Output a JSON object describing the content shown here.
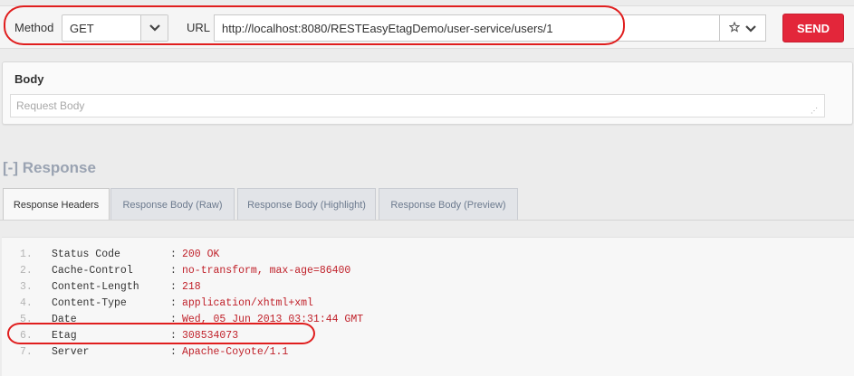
{
  "request": {
    "method_label": "Method",
    "method_value": "GET",
    "url_label": "URL",
    "url_value": "http://localhost:8080/RESTEasyEtagDemo/user-service/users/1",
    "send_label": "SEND"
  },
  "body": {
    "title": "Body",
    "placeholder": "Request Body"
  },
  "response": {
    "title": "[-] Response",
    "tabs": [
      {
        "label": "Response Headers",
        "active": true
      },
      {
        "label": "Response Body (Raw)",
        "active": false
      },
      {
        "label": "Response Body (Highlight)",
        "active": false
      },
      {
        "label": "Response Body (Preview)",
        "active": false
      }
    ],
    "headers": [
      {
        "num": "1.",
        "key": "Status Code",
        "sep": ":",
        "value": "200 OK"
      },
      {
        "num": "2.",
        "key": "Cache-Control",
        "sep": ":",
        "value": "no-transform, max-age=86400"
      },
      {
        "num": "3.",
        "key": "Content-Length",
        "sep": ":",
        "value": "218"
      },
      {
        "num": "4.",
        "key": "Content-Type",
        "sep": ":",
        "value": "application/xhtml+xml"
      },
      {
        "num": "5.",
        "key": "Date",
        "sep": ":",
        "value": "Wed, 05 Jun 2013 03:31:44 GMT"
      },
      {
        "num": "6.",
        "key": "Etag",
        "sep": ":",
        "value": "308534073"
      },
      {
        "num": "7.",
        "key": "Server",
        "sep": ":",
        "value": "Apache-Coyote/1.1"
      }
    ]
  },
  "colors": {
    "send_button": "#e3263a",
    "annotation_outline": "#e01e1e",
    "header_value": "#c0212a"
  },
  "icons": {
    "method_dropdown": "chevron-down-icon",
    "bookmark": "star-icon",
    "url_dropdown": "chevron-down-icon",
    "textarea_resize": "resize-grip-icon"
  }
}
